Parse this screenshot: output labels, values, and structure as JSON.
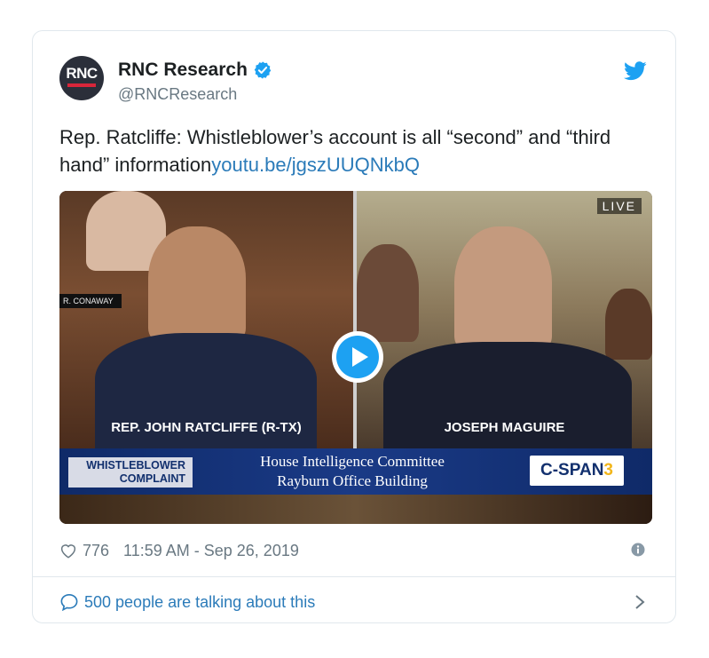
{
  "tweet": {
    "avatar_text": "RNC",
    "display_name": "RNC Research",
    "handle": "@RNCResearch",
    "text": "Rep. Ratcliffe: Whistleblower’s account is all “second” and “third hand” information",
    "link": "youtu.be/jgszUUQNkbQ"
  },
  "media": {
    "nameplate": "R. CONAWAY",
    "live_label": "LIVE",
    "caption_left": "REP. JOHN RATCLIFFE (R-TX)",
    "caption_right": "JOSEPH MAGUIRE",
    "lower_third_tag": "WHISTLEBLOWER COMPLAINT",
    "lower_third_line1": "House Intelligence Committee",
    "lower_third_line2": "Rayburn Office Building",
    "network_logo": "C-SPAN",
    "network_number": "3"
  },
  "meta": {
    "likes": "776",
    "timestamp": "11:59 AM - Sep 26, 2019"
  },
  "footer": {
    "talking": "500 people are talking about this"
  },
  "colors": {
    "link": "#2b7bb9",
    "muted": "#697882",
    "twitter_blue": "#1da1f2"
  },
  "icons": [
    "verified-badge-icon",
    "twitter-bird-icon",
    "play-icon",
    "heart-icon",
    "info-icon",
    "speech-bubble-icon",
    "chevron-right-icon"
  ]
}
